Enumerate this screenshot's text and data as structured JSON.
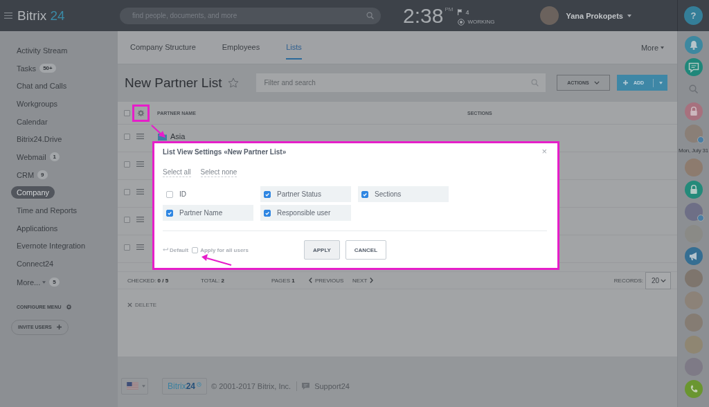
{
  "topbar": {
    "logo": {
      "name": "Bitrix",
      "number": "24"
    },
    "search": {
      "placeholder": "find people, documents, and more"
    },
    "clock": {
      "time": "2:38",
      "period": "PM"
    },
    "flag_count": "4",
    "work_status": "WORKING",
    "user": {
      "name": "Yana Prokopets"
    },
    "help": "?"
  },
  "sidebar": {
    "items": [
      {
        "label": "Activity Stream",
        "selected": false
      },
      {
        "label": "Tasks",
        "badge": "50+",
        "selected": false
      },
      {
        "label": "Chat and Calls",
        "selected": false
      },
      {
        "label": "Workgroups",
        "selected": false
      },
      {
        "label": "Calendar",
        "selected": false
      },
      {
        "label": "Bitrix24.Drive",
        "selected": false
      },
      {
        "label": "Webmail",
        "badge": "1",
        "selected": false
      },
      {
        "label": "CRM",
        "badge": "9",
        "selected": false
      },
      {
        "label": "Company",
        "selected": true
      },
      {
        "label": "Time and Reports",
        "selected": false
      },
      {
        "label": "Applications",
        "selected": false
      },
      {
        "label": "Evernote Integration",
        "selected": false
      },
      {
        "label": "Connect24",
        "selected": false
      }
    ],
    "more": {
      "label": "More...",
      "badge": "5"
    },
    "configure": "CONFIGURE MENU",
    "invite": "INVITE USERS"
  },
  "tabs": [
    {
      "label": "Company Structure",
      "selected": false
    },
    {
      "label": "Employees",
      "selected": false
    },
    {
      "label": "Lists",
      "selected": true
    }
  ],
  "tabs_more": "More",
  "page": {
    "title": "New Partner List",
    "starred": false,
    "filter": {
      "placeholder": "Filter and search"
    },
    "actions": "ACTIONS",
    "add": "ADD"
  },
  "table": {
    "all_checked": false,
    "columns": [
      "PARTNER NAME",
      "SECTIONS"
    ],
    "rows": [
      {
        "name": "Asia",
        "checked": false
      },
      {
        "checked": false
      },
      {
        "checked": false
      },
      {
        "checked": false
      },
      {
        "checked": false
      }
    ],
    "footer": {
      "checked": "CHECKED: **0 / 5**",
      "total": "TOTAL: **2**",
      "pages": "PAGES **1**",
      "previous": "PREVIOUS",
      "next": "NEXT",
      "records_label": "RECORDS:",
      "records_value": "20"
    },
    "delete": {
      "label": "DELETE",
      "disabled": true
    }
  },
  "dialog": {
    "title": "List View Settings «New Partner List»",
    "close": "×",
    "select_all": "Select all",
    "select_none": "Select none",
    "fields": [
      {
        "label": "ID",
        "checked": false
      },
      {
        "label": "Partner Status",
        "checked": true
      },
      {
        "label": "Sections",
        "checked": true
      },
      {
        "label": "Partner Name",
        "checked": true
      },
      {
        "label": "Responsible user",
        "checked": true
      }
    ],
    "default": "Default",
    "apply_all": {
      "label": "Apply for all users",
      "checked": false
    },
    "buttons": [
      {
        "label": "APPLY",
        "kind": "apply"
      },
      {
        "label": "CANCEL",
        "kind": "cancel"
      }
    ]
  },
  "footer": {
    "logo": {
      "name": "Bitrix",
      "number": "24"
    },
    "copyright": "© 2001-2017 Bitrix, Inc.",
    "support": "Support24"
  },
  "right_bar": {
    "date": "Mon, July 31"
  }
}
